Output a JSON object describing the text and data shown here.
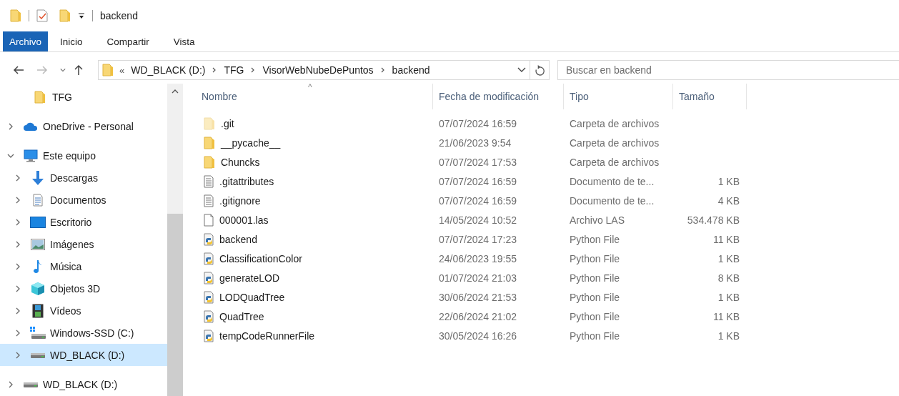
{
  "window": {
    "title": "backend"
  },
  "ribbon_tabs": [
    {
      "label": "Archivo",
      "selected": true
    },
    {
      "label": "Inicio",
      "selected": false
    },
    {
      "label": "Compartir",
      "selected": false
    },
    {
      "label": "Vista",
      "selected": false
    }
  ],
  "address_bar": {
    "overflow": "«",
    "path": [
      "WD_BLACK (D:)",
      "TFG",
      "VisorWebNubeDePuntos",
      "backend"
    ]
  },
  "search": {
    "placeholder": "Buscar en backend"
  },
  "sidebar": {
    "items": [
      {
        "label": "TFG",
        "kind": "folder",
        "selected": false
      },
      {
        "label": "OneDrive - Personal",
        "kind": "cloud",
        "expanded": false,
        "selected": false
      },
      {
        "label": "Este equipo",
        "kind": "monitor",
        "expanded": true,
        "selected": false,
        "children": [
          {
            "label": "Descargas",
            "kind": "download",
            "expanded": false,
            "selected": false
          },
          {
            "label": "Documentos",
            "kind": "document",
            "expanded": false,
            "selected": false
          },
          {
            "label": "Escritorio",
            "kind": "desktop",
            "expanded": false,
            "selected": false
          },
          {
            "label": "Imágenes",
            "kind": "image",
            "expanded": false,
            "selected": false
          },
          {
            "label": "Música",
            "kind": "music",
            "expanded": false,
            "selected": false
          },
          {
            "label": "Objetos 3D",
            "kind": "cube",
            "expanded": false,
            "selected": false
          },
          {
            "label": "Vídeos",
            "kind": "film",
            "expanded": false,
            "selected": false
          },
          {
            "label": "Windows-SSD (C:)",
            "kind": "system-drive",
            "expanded": false,
            "selected": false
          },
          {
            "label": "WD_BLACK (D:)",
            "kind": "drive",
            "expanded": false,
            "selected": true
          }
        ]
      },
      {
        "label": "WD_BLACK (D:)",
        "kind": "drive",
        "expanded": false,
        "selected": false
      }
    ]
  },
  "table": {
    "sort_indicator": "^",
    "columns": [
      "Nombre",
      "Fecha de modificación",
      "Tipo",
      "Tamaño"
    ],
    "rows": [
      {
        "kind": "folder",
        "hidden": true,
        "name": ".git",
        "date": "07/07/2024 16:59",
        "type": "Carpeta de archivos"
      },
      {
        "kind": "folder",
        "hidden": false,
        "name": "__pycache__",
        "date": "21/06/2023 9:54",
        "type": "Carpeta de archivos"
      },
      {
        "kind": "folder",
        "hidden": false,
        "name": "Chuncks",
        "date": "07/07/2024 17:53",
        "type": "Carpeta de archivos"
      },
      {
        "kind": "text",
        "hidden": false,
        "name": ".gitattributes",
        "date": "07/07/2024 16:59",
        "type": "Documento de te...",
        "size": "1 KB"
      },
      {
        "kind": "text",
        "hidden": false,
        "name": ".gitignore",
        "date": "07/07/2024 16:59",
        "type": "Documento de te...",
        "size": "4 KB"
      },
      {
        "kind": "blank",
        "hidden": false,
        "name": "000001.las",
        "date": "14/05/2024 10:52",
        "type": "Archivo LAS",
        "size": "534.478 KB"
      },
      {
        "kind": "python",
        "hidden": false,
        "name": "backend",
        "date": "07/07/2024 17:23",
        "type": "Python File",
        "size": "11 KB"
      },
      {
        "kind": "python",
        "hidden": false,
        "name": "ClassificationColor",
        "date": "24/06/2023 19:55",
        "type": "Python File",
        "size": "1 KB"
      },
      {
        "kind": "python",
        "hidden": false,
        "name": "generateLOD",
        "date": "01/07/2024 21:03",
        "type": "Python File",
        "size": "8 KB"
      },
      {
        "kind": "python",
        "hidden": false,
        "name": "LODQuadTree",
        "date": "30/06/2024 21:53",
        "type": "Python File",
        "size": "1 KB"
      },
      {
        "kind": "python",
        "hidden": false,
        "name": "QuadTree",
        "date": "22/06/2024 21:02",
        "type": "Python File",
        "size": "11 KB"
      },
      {
        "kind": "python",
        "hidden": false,
        "name": "tempCodeRunnerFile",
        "date": "30/05/2024 16:26",
        "type": "Python File",
        "size": "1 KB"
      }
    ]
  }
}
